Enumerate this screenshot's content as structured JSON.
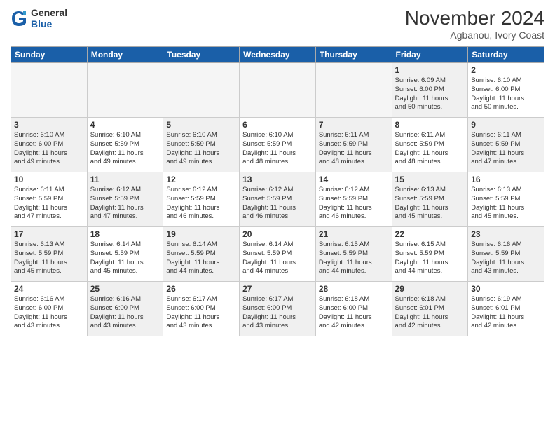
{
  "header": {
    "logo_general": "General",
    "logo_blue": "Blue",
    "month_title": "November 2024",
    "location": "Agbanou, Ivory Coast"
  },
  "days_of_week": [
    "Sunday",
    "Monday",
    "Tuesday",
    "Wednesday",
    "Thursday",
    "Friday",
    "Saturday"
  ],
  "weeks": [
    [
      {
        "day": "",
        "empty": true
      },
      {
        "day": "",
        "empty": true
      },
      {
        "day": "",
        "empty": true
      },
      {
        "day": "",
        "empty": true
      },
      {
        "day": "",
        "empty": true
      },
      {
        "day": "1",
        "shaded": true,
        "info": "Sunrise: 6:09 AM\nSunset: 6:00 PM\nDaylight: 11 hours\nand 50 minutes."
      },
      {
        "day": "2",
        "info": "Sunrise: 6:10 AM\nSunset: 6:00 PM\nDaylight: 11 hours\nand 50 minutes."
      }
    ],
    [
      {
        "day": "3",
        "shaded": true,
        "info": "Sunrise: 6:10 AM\nSunset: 6:00 PM\nDaylight: 11 hours\nand 49 minutes."
      },
      {
        "day": "4",
        "info": "Sunrise: 6:10 AM\nSunset: 5:59 PM\nDaylight: 11 hours\nand 49 minutes."
      },
      {
        "day": "5",
        "shaded": true,
        "info": "Sunrise: 6:10 AM\nSunset: 5:59 PM\nDaylight: 11 hours\nand 49 minutes."
      },
      {
        "day": "6",
        "info": "Sunrise: 6:10 AM\nSunset: 5:59 PM\nDaylight: 11 hours\nand 48 minutes."
      },
      {
        "day": "7",
        "shaded": true,
        "info": "Sunrise: 6:11 AM\nSunset: 5:59 PM\nDaylight: 11 hours\nand 48 minutes."
      },
      {
        "day": "8",
        "info": "Sunrise: 6:11 AM\nSunset: 5:59 PM\nDaylight: 11 hours\nand 48 minutes."
      },
      {
        "day": "9",
        "shaded": true,
        "info": "Sunrise: 6:11 AM\nSunset: 5:59 PM\nDaylight: 11 hours\nand 47 minutes."
      }
    ],
    [
      {
        "day": "10",
        "info": "Sunrise: 6:11 AM\nSunset: 5:59 PM\nDaylight: 11 hours\nand 47 minutes."
      },
      {
        "day": "11",
        "shaded": true,
        "info": "Sunrise: 6:12 AM\nSunset: 5:59 PM\nDaylight: 11 hours\nand 47 minutes."
      },
      {
        "day": "12",
        "info": "Sunrise: 6:12 AM\nSunset: 5:59 PM\nDaylight: 11 hours\nand 46 minutes."
      },
      {
        "day": "13",
        "shaded": true,
        "info": "Sunrise: 6:12 AM\nSunset: 5:59 PM\nDaylight: 11 hours\nand 46 minutes."
      },
      {
        "day": "14",
        "info": "Sunrise: 6:12 AM\nSunset: 5:59 PM\nDaylight: 11 hours\nand 46 minutes."
      },
      {
        "day": "15",
        "shaded": true,
        "info": "Sunrise: 6:13 AM\nSunset: 5:59 PM\nDaylight: 11 hours\nand 45 minutes."
      },
      {
        "day": "16",
        "info": "Sunrise: 6:13 AM\nSunset: 5:59 PM\nDaylight: 11 hours\nand 45 minutes."
      }
    ],
    [
      {
        "day": "17",
        "shaded": true,
        "info": "Sunrise: 6:13 AM\nSunset: 5:59 PM\nDaylight: 11 hours\nand 45 minutes."
      },
      {
        "day": "18",
        "info": "Sunrise: 6:14 AM\nSunset: 5:59 PM\nDaylight: 11 hours\nand 45 minutes."
      },
      {
        "day": "19",
        "shaded": true,
        "info": "Sunrise: 6:14 AM\nSunset: 5:59 PM\nDaylight: 11 hours\nand 44 minutes."
      },
      {
        "day": "20",
        "info": "Sunrise: 6:14 AM\nSunset: 5:59 PM\nDaylight: 11 hours\nand 44 minutes."
      },
      {
        "day": "21",
        "shaded": true,
        "info": "Sunrise: 6:15 AM\nSunset: 5:59 PM\nDaylight: 11 hours\nand 44 minutes."
      },
      {
        "day": "22",
        "info": "Sunrise: 6:15 AM\nSunset: 5:59 PM\nDaylight: 11 hours\nand 44 minutes."
      },
      {
        "day": "23",
        "shaded": true,
        "info": "Sunrise: 6:16 AM\nSunset: 5:59 PM\nDaylight: 11 hours\nand 43 minutes."
      }
    ],
    [
      {
        "day": "24",
        "info": "Sunrise: 6:16 AM\nSunset: 6:00 PM\nDaylight: 11 hours\nand 43 minutes."
      },
      {
        "day": "25",
        "shaded": true,
        "info": "Sunrise: 6:16 AM\nSunset: 6:00 PM\nDaylight: 11 hours\nand 43 minutes."
      },
      {
        "day": "26",
        "info": "Sunrise: 6:17 AM\nSunset: 6:00 PM\nDaylight: 11 hours\nand 43 minutes."
      },
      {
        "day": "27",
        "shaded": true,
        "info": "Sunrise: 6:17 AM\nSunset: 6:00 PM\nDaylight: 11 hours\nand 43 minutes."
      },
      {
        "day": "28",
        "info": "Sunrise: 6:18 AM\nSunset: 6:00 PM\nDaylight: 11 hours\nand 42 minutes."
      },
      {
        "day": "29",
        "shaded": true,
        "info": "Sunrise: 6:18 AM\nSunset: 6:01 PM\nDaylight: 11 hours\nand 42 minutes."
      },
      {
        "day": "30",
        "info": "Sunrise: 6:19 AM\nSunset: 6:01 PM\nDaylight: 11 hours\nand 42 minutes."
      }
    ]
  ]
}
